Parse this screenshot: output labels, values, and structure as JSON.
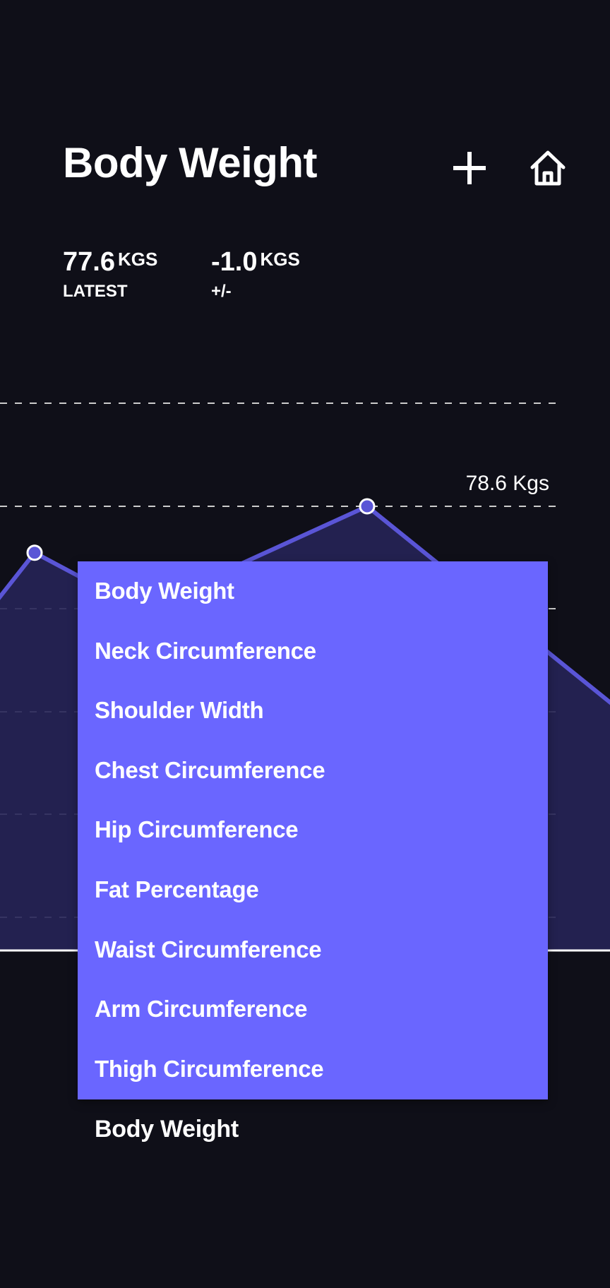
{
  "header": {
    "title": "Body Weight",
    "add_icon": "plus-icon",
    "home_icon": "home-icon"
  },
  "stats": {
    "latest": {
      "value": "77.6",
      "unit": "KGS",
      "label": "LATEST"
    },
    "change": {
      "value": "-1.0",
      "unit": "KGS",
      "label": "+/-"
    }
  },
  "chart_data": {
    "type": "area",
    "y_unit": "Kgs",
    "series": [
      {
        "values": [
          77.2,
          78.15,
          77.6,
          78.6,
          76.5
        ]
      }
    ],
    "annotation": "78.6 Kgs",
    "grid": true,
    "colors": {
      "line": "#5a55d6",
      "fill": "#262456",
      "grid": "#cccccc"
    }
  },
  "dropdown": {
    "options": [
      "Body Weight",
      "Neck Circumference",
      "Shoulder Width",
      "Chest Circumference",
      "Hip Circumference",
      "Fat Percentage",
      "Waist Circumference",
      "Arm Circumference",
      "Thigh Circumference"
    ],
    "selected": "Body Weight",
    "color": "#6a66ff"
  }
}
